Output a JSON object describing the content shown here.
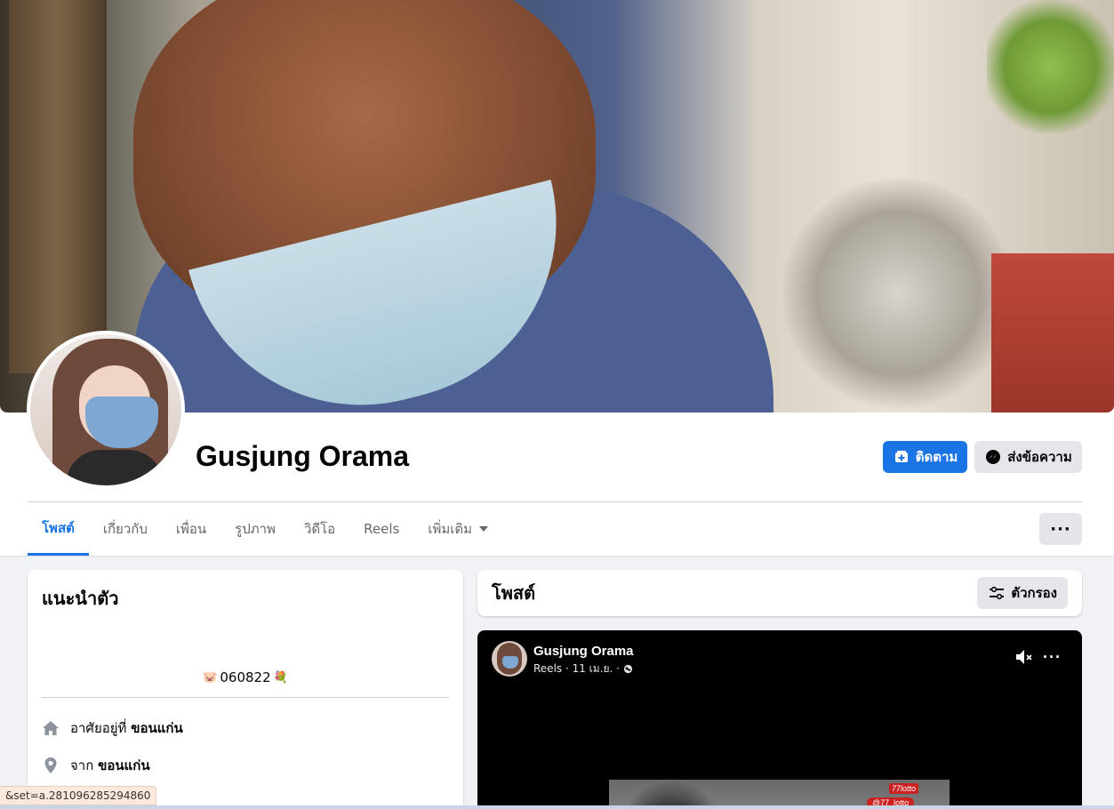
{
  "profile": {
    "name": "Gusjung Orama"
  },
  "actions": {
    "follow_label": "ติดตาม",
    "message_label": "ส่งข้อความ",
    "more_label": "···"
  },
  "tabs": [
    {
      "label": "โพสต์",
      "active": true
    },
    {
      "label": "เกี่ยวกับ",
      "active": false
    },
    {
      "label": "เพื่อน",
      "active": false
    },
    {
      "label": "รูปภาพ",
      "active": false
    },
    {
      "label": "วิดีโอ",
      "active": false
    },
    {
      "label": "Reels",
      "active": false
    },
    {
      "label": "เพิ่มเติม",
      "active": false
    }
  ],
  "intro": {
    "title": "แนะนำตัว",
    "bio_prefix_emoji": "🐷",
    "bio_text": "060822",
    "bio_suffix_emoji": "💐",
    "lives_in_label": "อาศัยอยู่ที่",
    "lives_in_value": "ขอนแก่น",
    "from_label": "จาก",
    "from_value": "ขอนแก่น"
  },
  "posts": {
    "title": "โพสต์",
    "filter_label": "ตัวกรอง"
  },
  "reel": {
    "author": "Gusjung Orama",
    "meta": "Reels · 11 เม.ย. ·",
    "more_label": "···",
    "badge_text": "77lotto",
    "handle_text": "@77_lotto"
  },
  "status_bar": {
    "url_text": "&set=a.281096285294860"
  },
  "colors": {
    "accent": "#1b74e4",
    "button_gray": "#e4e6eb",
    "page_bg": "#f0f2f5"
  },
  "icons": {
    "follow": "follow-plus-icon",
    "message": "messenger-icon",
    "filter": "filter-sliders-icon",
    "home": "home-icon",
    "location": "location-pin-icon",
    "globe": "globe-icon",
    "mute": "speaker-muted-icon"
  }
}
